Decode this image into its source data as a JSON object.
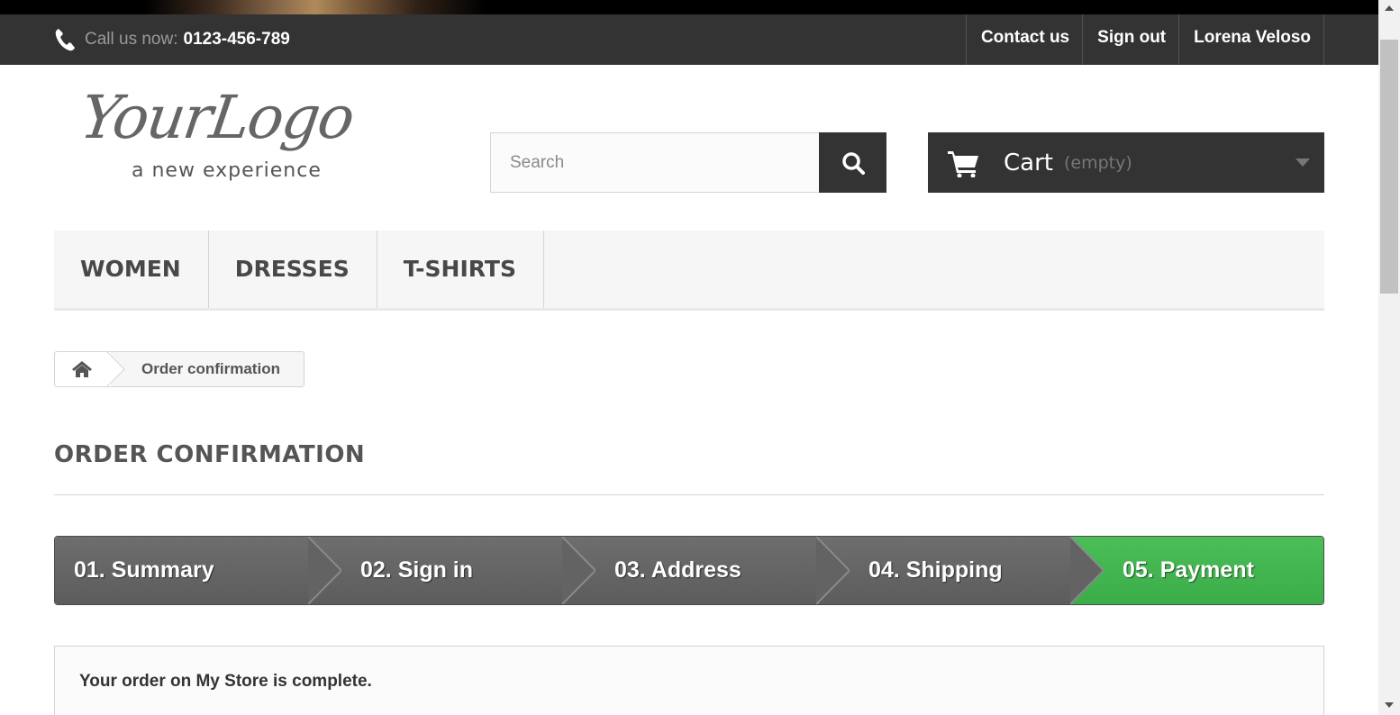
{
  "header": {
    "phone_prefix": "Call us now:",
    "phone_number": "0123-456-789",
    "links": [
      "Contact us",
      "Sign out",
      "Lorena Veloso"
    ]
  },
  "logo": {
    "script": "YourLogo",
    "tagline": "a new experience"
  },
  "search": {
    "placeholder": "Search"
  },
  "cart": {
    "label": "Cart",
    "status": "(empty)"
  },
  "menu": {
    "items": [
      "WOMEN",
      "DRESSES",
      "T-SHIRTS"
    ]
  },
  "breadcrumb": {
    "current": "Order confirmation"
  },
  "page": {
    "heading": "ORDER CONFIRMATION"
  },
  "steps": {
    "items": [
      "01. Summary",
      "02. Sign in",
      "03. Address",
      "04. Shipping",
      "05. Payment"
    ],
    "active_index": 4
  },
  "confirmation": {
    "message": "Your order on My Store is complete."
  },
  "colors": {
    "topbar": "#333333",
    "step_inactive": "#666666",
    "step_active": "#43b155"
  },
  "icons": [
    "phone-icon",
    "search-icon",
    "cart-icon",
    "chevron-down-icon",
    "home-icon"
  ]
}
